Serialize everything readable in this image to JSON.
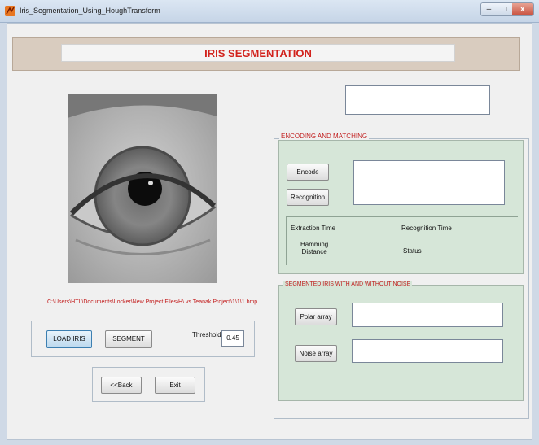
{
  "window": {
    "title": "Iris_Segmentation_Using_HoughTransform",
    "controls": [
      "–",
      "□",
      "x"
    ]
  },
  "header": {
    "title": "IRIS SEGMENTATION"
  },
  "left": {
    "image_path": "C:\\Users\\HTL\\Documents\\Locker\\New Project Files\\H\\ vs Teanak Project\\1\\1\\1.bmp",
    "load_button": "LOAD IRIS",
    "segment_button": "SEGMENT",
    "threshold_label": "Threshold",
    "threshold_value": "0.45",
    "back_button": "<<Back",
    "exit_button": "Exit"
  },
  "encoding": {
    "legend": "ENCODING AND MATCHING",
    "encode_button": "Encode",
    "recognition_button": "Recognition",
    "extraction_time_label": "Extraction Time",
    "recognition_time_label": "Recognition Time",
    "hamming_label_line1": "Hamming",
    "hamming_label_line2": "Distance",
    "status_label": "Status"
  },
  "segmented": {
    "legend": "SEGMENTED IRIS WITH AND WITHOUT NOISE",
    "polar_button": "Polar array",
    "noise_button": "Noise array"
  }
}
